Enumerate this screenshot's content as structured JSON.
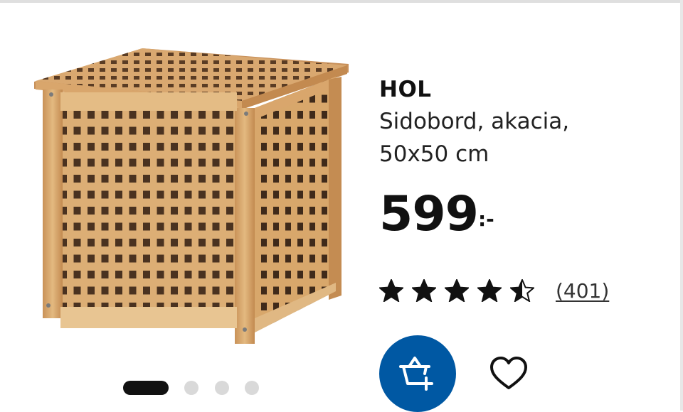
{
  "product": {
    "name": "HOL",
    "description_line1": "Sidobord, akacia,",
    "description_line2": "50x50 cm",
    "price_integer": "599",
    "price_suffix": ":-",
    "rating": {
      "stars": 4.5,
      "max_stars": 5,
      "review_count": "(401)"
    }
  },
  "gallery": {
    "image_icon": "wooden-slatted-side-table",
    "total_images": 4,
    "active_index": 1
  },
  "actions": {
    "cart_icon": "add-to-basket-icon",
    "favourite_icon": "heart-outline-icon"
  },
  "colors": {
    "brand_blue": "#0058a3",
    "wood_light": "#e2b884",
    "wood_dark": "#b98650"
  }
}
